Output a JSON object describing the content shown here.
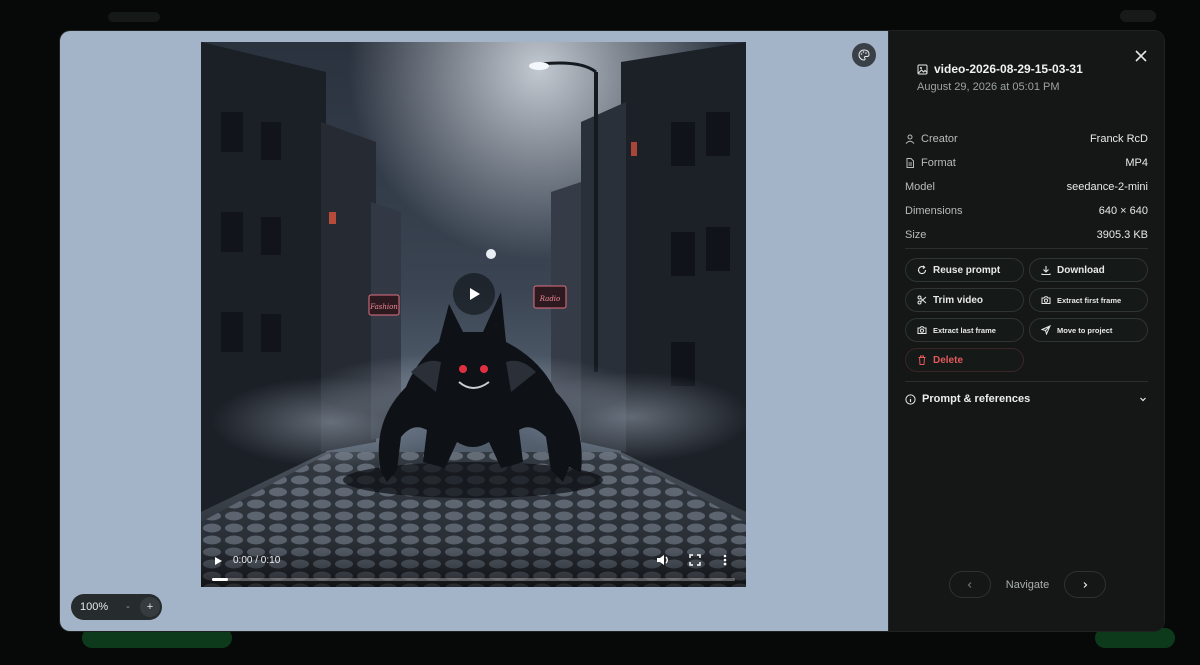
{
  "media": {
    "time": "0:00 / 0:10",
    "progress": 0.03,
    "sign_left": "Fashion",
    "sign_right": "Radio"
  },
  "zoom": {
    "value": "100%",
    "minus": "-",
    "plus": "+"
  },
  "panel": {
    "title": "video-2026-08-29-15-03-31",
    "date": "August 29, 2026 at 05:01 PM",
    "meta": [
      {
        "key": "Creator",
        "value": "Franck RcD",
        "icon": "user-icon"
      },
      {
        "key": "Format",
        "value": "MP4",
        "icon": "file-icon"
      },
      {
        "key": "Model",
        "value": "seedance-2-mini",
        "icon": ""
      },
      {
        "key": "Dimensions",
        "value": "640 × 640",
        "icon": ""
      },
      {
        "key": "Size",
        "value": "3905.3 KB",
        "icon": ""
      }
    ],
    "actions": {
      "reuse": "Reuse prompt",
      "download": "Download",
      "trim": "Trim video",
      "extract_first": "Extract first frame",
      "extract_last": "Extract last frame",
      "move": "Move to project",
      "delete": "Delete"
    },
    "prompt_label": "Prompt & references",
    "nav_label": "Navigate"
  },
  "colors": {
    "stage_bg": "#a3b4c9",
    "panel_bg": "#141716",
    "danger": "#e05a5a",
    "accent_green": "#0e3a1c"
  }
}
